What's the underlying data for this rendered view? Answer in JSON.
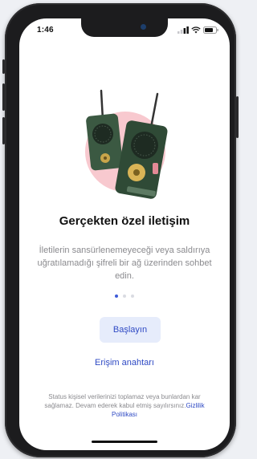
{
  "status_bar": {
    "time": "1:46",
    "icons": [
      "signal-icon",
      "wifi-icon",
      "battery-icon"
    ]
  },
  "onboarding": {
    "illustration": "walkie-talkie-illustration",
    "title": "Gerçekten özel iletişim",
    "description": "İletilerin sansürlenemeyeceği veya saldırıya uğratılamadığı şifreli bir ağ üzerinden sohbet edin.",
    "pagination": {
      "pages": 3,
      "current": 1
    }
  },
  "actions": {
    "start_label": "Başlayın",
    "access_key_label": "Erişim anahtarı"
  },
  "footer": {
    "text": "Status kişisel verilerinizi toplamaz veya bunlardan kar sağlamaz. Devam ederek kabul etmiş sayılırsınız.",
    "privacy_link": "Gizlilik Politikası"
  },
  "colors": {
    "accent": "#2f4ac4",
    "button_bg": "#e6ecfb",
    "pink_circle": "#f8c9cf",
    "device_green": "#2f4a36"
  }
}
